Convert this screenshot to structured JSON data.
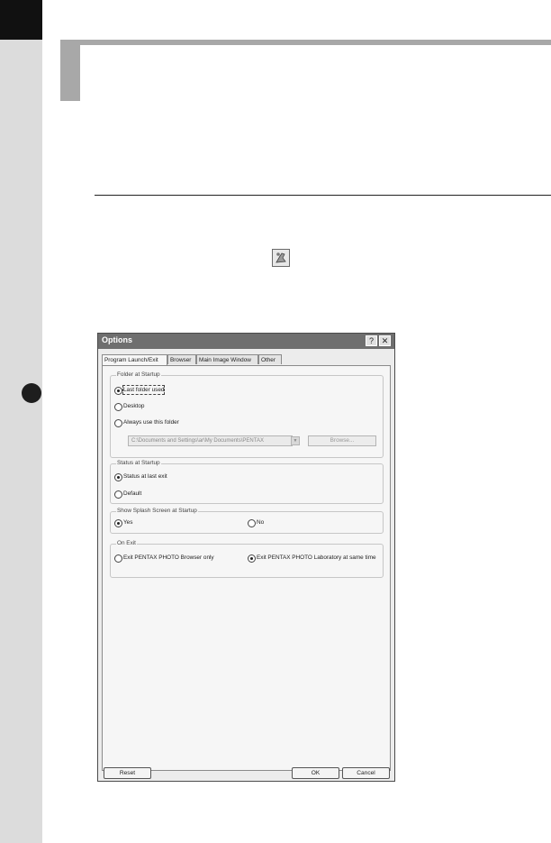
{
  "dialog": {
    "title": "Options",
    "help_button": "?",
    "close_button": "✕",
    "tabs": [
      {
        "label": "Program Launch/Exit"
      },
      {
        "label": "Browser"
      },
      {
        "label": "Main Image Window"
      },
      {
        "label": "Other"
      }
    ],
    "folder_group": {
      "label": "Folder at Startup",
      "options": [
        "Last folder used",
        "Desktop",
        "Always use this folder"
      ],
      "path_value": "C:\\Documents and Settings\\ar\\My Documents\\PENTAX",
      "browse_label": "Browse..."
    },
    "status_group": {
      "label": "Status at Startup",
      "options": [
        "Status at last exit",
        "Default"
      ]
    },
    "splash_group": {
      "label": "Show Splash Screen at Startup",
      "options": [
        "Yes",
        "No"
      ]
    },
    "exit_group": {
      "label": "On Exit",
      "options": [
        "Exit PENTAX PHOTO Browser only",
        "Exit PENTAX PHOTO Laboratory at same time"
      ]
    },
    "reset_label": "Reset",
    "ok_label": "OK",
    "cancel_label": "Cancel"
  }
}
